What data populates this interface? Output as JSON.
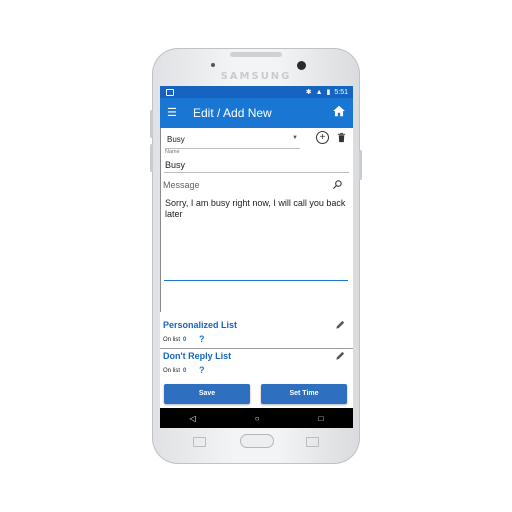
{
  "device": {
    "brand": "SAMSUNG"
  },
  "status_bar": {
    "time": "5:51",
    "bluetooth_icon": "bluetooth-icon",
    "signal_icon": "signal-icon",
    "battery_icon": "battery-icon"
  },
  "app_bar": {
    "menu_icon": "menu-icon",
    "title": "Edit / Add New",
    "home_icon": "home-icon"
  },
  "form": {
    "selected_template": "Busy",
    "name_label": "Name",
    "name_value": "Busy",
    "message_label": "Message",
    "message_text": "Sorry, I am busy right now, I will call you back later"
  },
  "lists": [
    {
      "title": "Personalized List",
      "on_list_label": "On list",
      "count": "0",
      "help": "?"
    },
    {
      "title": "Don't Reply List",
      "on_list_label": "On list",
      "count": "0",
      "help": "?"
    }
  ],
  "actions": {
    "save_label": "Save",
    "set_time_label": "Set Time"
  },
  "nav": {
    "back": "◁",
    "home": "○",
    "recents": "□"
  },
  "colors": {
    "primary": "#1976d2",
    "status_bar": "#1565c0",
    "button": "#2f6fc0"
  }
}
